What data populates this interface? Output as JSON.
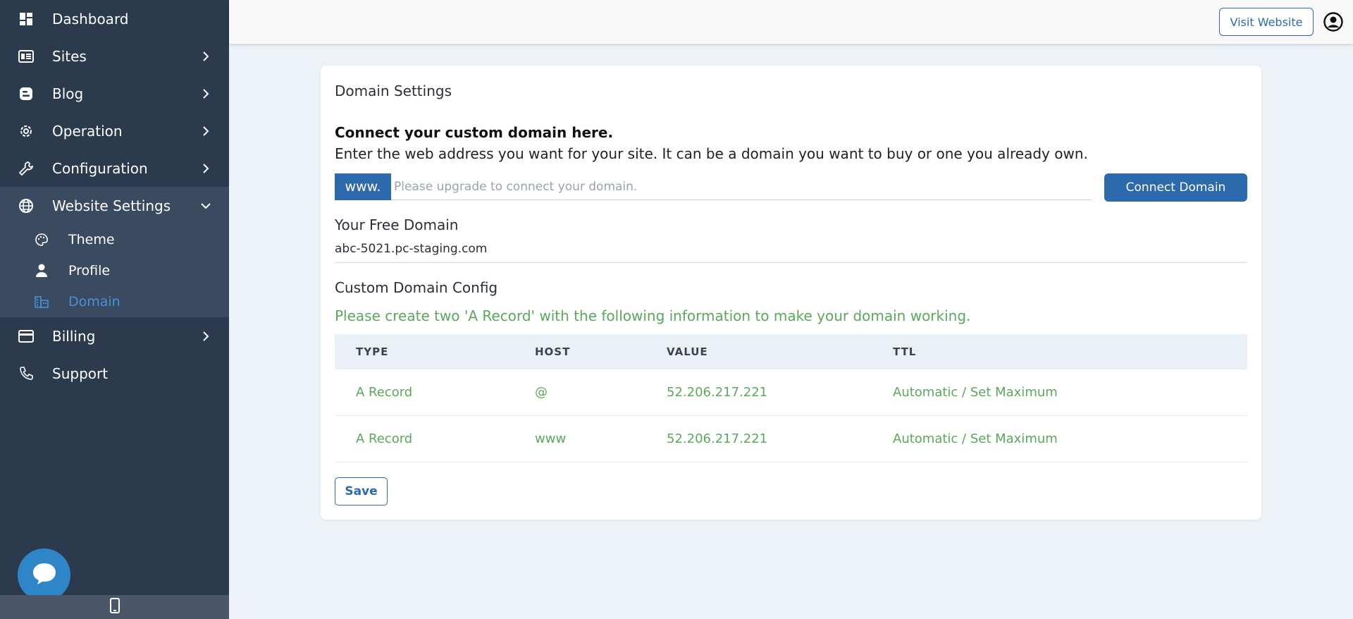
{
  "sidebar": {
    "items": [
      {
        "label": "Dashboard",
        "icon": "dashboard-icon"
      },
      {
        "label": "Sites",
        "icon": "sites-icon"
      },
      {
        "label": "Blog",
        "icon": "blog-icon"
      },
      {
        "label": "Operation",
        "icon": "gear-icon"
      },
      {
        "label": "Configuration",
        "icon": "wrench-icon"
      },
      {
        "label": "Website Settings",
        "icon": "globe-icon"
      },
      {
        "label": "Billing",
        "icon": "credit-card-icon"
      },
      {
        "label": "Support",
        "icon": "phone-icon"
      }
    ],
    "website_settings_children": [
      {
        "label": "Theme",
        "icon": "palette-icon"
      },
      {
        "label": "Profile",
        "icon": "user-icon"
      },
      {
        "label": "Domain",
        "icon": "building-icon",
        "active": true
      }
    ]
  },
  "topbar": {
    "visit_label": "Visit Website"
  },
  "card": {
    "title": "Domain Settings",
    "connect_heading": "Connect your custom domain here.",
    "connect_desc": "Enter the web address you want for your site. It can be a domain you want to buy or one you already own.",
    "www_prefix": "www.",
    "input_placeholder": "Please upgrade to connect your domain.",
    "input_value": "",
    "connect_button": "Connect Domain",
    "free_heading": "Your Free Domain",
    "free_domain": "abc-5021.pc-staging.com",
    "custom_heading": "Custom Domain Config",
    "custom_note": "Please create two 'A Record' with the following information to make your domain working.",
    "table": {
      "headers": [
        "TYPE",
        "HOST",
        "VALUE",
        "TTL"
      ],
      "rows": [
        [
          "A Record",
          "@",
          "52.206.217.221",
          "Automatic / Set Maximum"
        ],
        [
          "A Record",
          "www",
          "52.206.217.221",
          "Automatic / Set Maximum"
        ]
      ]
    },
    "save_button": "Save"
  },
  "colors": {
    "sidebar_bg": "#2c3a4e",
    "sidebar_group_bg": "#3a4a60",
    "accent": "#2c6aad",
    "active_link": "#4a8fd8",
    "success_text": "#5aa85a",
    "page_bg": "#edf1f8"
  }
}
